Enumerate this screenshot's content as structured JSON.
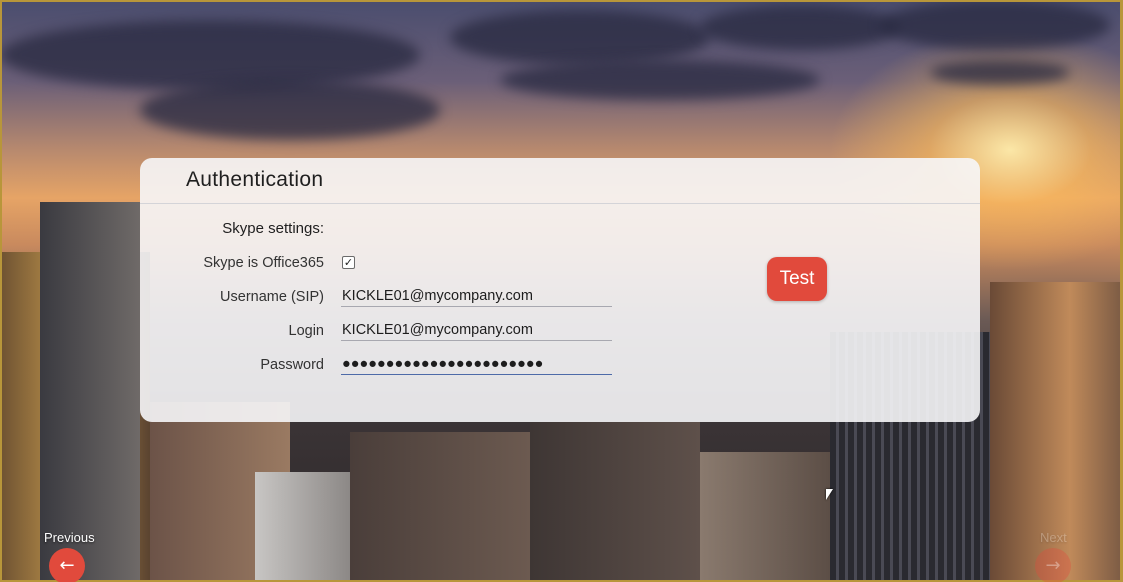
{
  "panel": {
    "title": "Authentication"
  },
  "form": {
    "section_label": "Skype settings:",
    "office365": {
      "label": "Skype is Office365",
      "checked": true,
      "check_glyph": "✓"
    },
    "username": {
      "label": "Username (SIP)",
      "value": "KICKLE01@mycompany.com"
    },
    "login": {
      "label": "Login",
      "value": "KICKLE01@mycompany.com"
    },
    "password": {
      "label": "Password",
      "value": "●●●●●●●●●●●●●●●●●●●●●●●"
    }
  },
  "test_button": {
    "label": "Test",
    "color": "#e14a3c"
  },
  "nav": {
    "previous": {
      "label": "Previous",
      "icon": "arrow-left-icon",
      "glyph": "←"
    },
    "next": {
      "label": "Next",
      "icon": "arrow-right-icon",
      "glyph": "→"
    }
  },
  "colors": {
    "accent": "#e14a3c",
    "frame": "#b8963a"
  }
}
